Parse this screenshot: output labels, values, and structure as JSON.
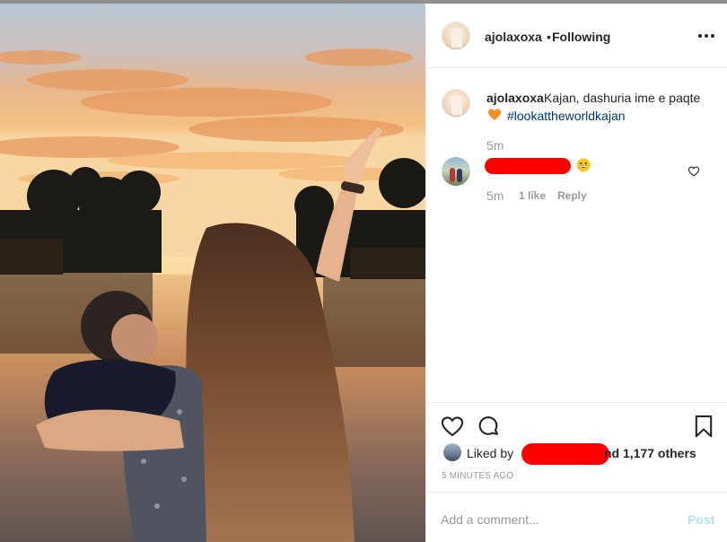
{
  "post": {
    "username": "ajolaxoxa",
    "separator": "•",
    "follow_status": "Following",
    "more_icon": "more-options-icon",
    "photo_description_icon": "photo"
  },
  "caption": {
    "username": "ajolaxoxa",
    "text": "Kajan, dashuria ime e paqte",
    "emoji": "orange-heart-icon",
    "hashtag": "#lookattheworldkajan",
    "time": "5m"
  },
  "comments": [
    {
      "username": "c",
      "emoji": "grinning-face-icon",
      "time": "5m",
      "likes": "1 like",
      "reply_label": "Reply"
    }
  ],
  "actions": {
    "like_icon": "heart-outline-icon",
    "comment_icon": "comment-bubble-icon",
    "save_icon": "bookmark-icon"
  },
  "likes": {
    "prefix": "Liked by",
    "first_liker": "c",
    "suffix": "nd 1,177 others",
    "posted_ago": "5 MINUTES AGO"
  },
  "comment_box": {
    "placeholder": "Add a comment...",
    "post_label": "Post"
  },
  "colors": {
    "text": "#262626",
    "muted": "#999999",
    "link": "#003569",
    "post_disabled": "#b2dffc",
    "redaction": "#ff0000",
    "border": "#efefef"
  }
}
